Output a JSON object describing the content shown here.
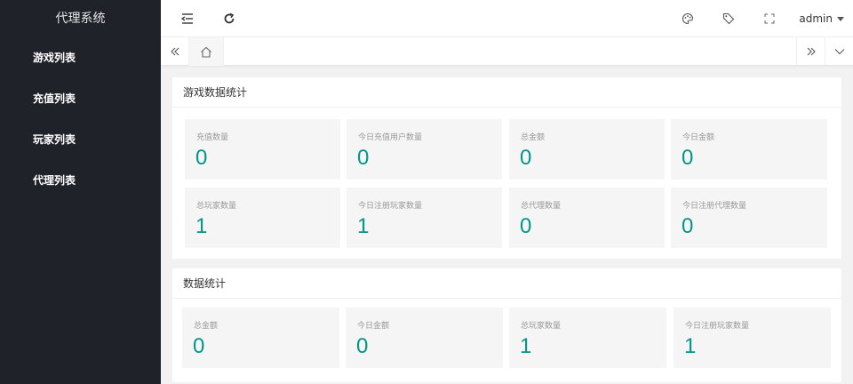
{
  "app": {
    "title": "代理系统"
  },
  "sidebar": {
    "items": [
      {
        "label": "游戏列表"
      },
      {
        "label": "充值列表"
      },
      {
        "label": "玩家列表"
      },
      {
        "label": "代理列表"
      }
    ]
  },
  "header": {
    "icons": [
      "menu-fold-icon",
      "refresh-icon",
      "theme-icon",
      "tag-icon",
      "fullscreen-icon"
    ],
    "user": "admin"
  },
  "tabs": {
    "icons": [
      "double-left-icon",
      "home-icon",
      "double-right-icon",
      "chevron-down-icon"
    ]
  },
  "game_stats": {
    "title": "游戏数据统计",
    "items": [
      {
        "label": "充值数量",
        "value": "0"
      },
      {
        "label": "今日充值用户数量",
        "value": "0"
      },
      {
        "label": "总金额",
        "value": "0"
      },
      {
        "label": "今日金额",
        "value": "0"
      },
      {
        "label": "总玩家数量",
        "value": "1"
      },
      {
        "label": "今日注册玩家数量",
        "value": "1"
      },
      {
        "label": "总代理数量",
        "value": "0"
      },
      {
        "label": "今日注册代理数量",
        "value": "0"
      }
    ]
  },
  "data_stats": {
    "title": "数据统计",
    "items": [
      {
        "label": "总金额",
        "value": "0"
      },
      {
        "label": "今日金额",
        "value": "0"
      },
      {
        "label": "总玩家数量",
        "value": "1"
      },
      {
        "label": "今日注册玩家数量",
        "value": "1"
      }
    ]
  },
  "colors": {
    "sidebar_bg": "#20222a",
    "accent": "#009688",
    "page_bg": "#f2f2f2"
  }
}
